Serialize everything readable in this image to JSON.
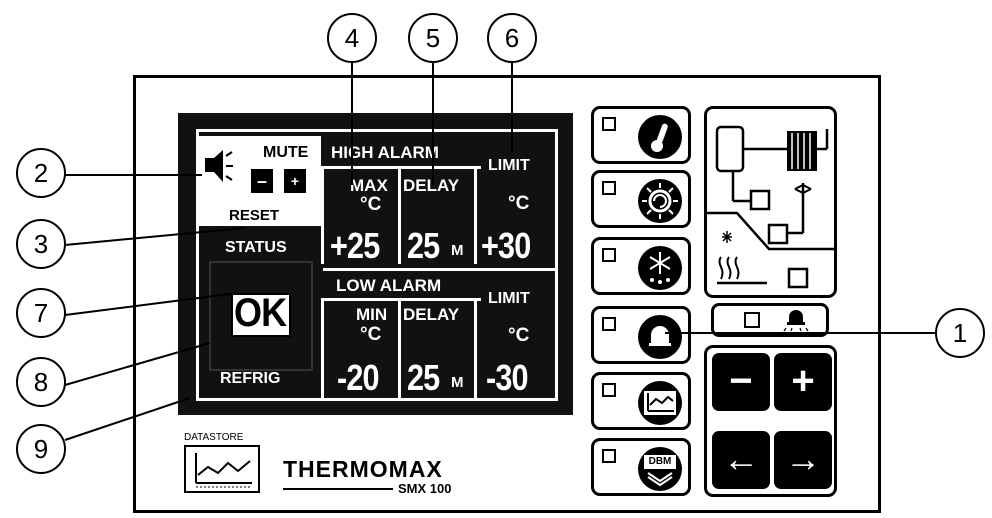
{
  "callouts": {
    "c1": "1",
    "c2": "2",
    "c3": "3",
    "c4": "4",
    "c5": "5",
    "c6": "6",
    "c7": "7",
    "c8": "8",
    "c9": "9"
  },
  "screen": {
    "mute": "MUTE",
    "minus": "–",
    "plus": "+",
    "reset": "RESET",
    "status": "STATUS",
    "status_value": "OK",
    "mode": "REFRIG",
    "high_alarm": {
      "title": "HIGH ALARM",
      "max_label": "MAX",
      "max_unit": "°C",
      "max_value": "+25",
      "delay_label": "DELAY",
      "delay_value": "25",
      "delay_unit": "M",
      "limit_label": "LIMIT",
      "limit_unit": "°C",
      "limit_value": "+30"
    },
    "low_alarm": {
      "title": "LOW ALARM",
      "min_label": "MIN",
      "min_unit": "°C",
      "min_value": "-20",
      "delay_label": "DELAY",
      "delay_value": "25",
      "delay_unit": "M",
      "limit_label": "LIMIT",
      "limit_unit": "°C",
      "limit_value": "-30"
    }
  },
  "brand": {
    "datastore": "DATASTORE",
    "name": "THERMOMAX",
    "model": "SMX 100"
  },
  "buttons": {
    "temperature": "thermometer-icon",
    "defrost": "defrost-icon",
    "snowflake": "snowflake-icon",
    "alarm": "alarm-bell-icon",
    "graph": "graph-icon",
    "dbm": "DBM"
  },
  "keys": {
    "minus": "−",
    "plus": "+",
    "left": "←",
    "right": "→"
  }
}
